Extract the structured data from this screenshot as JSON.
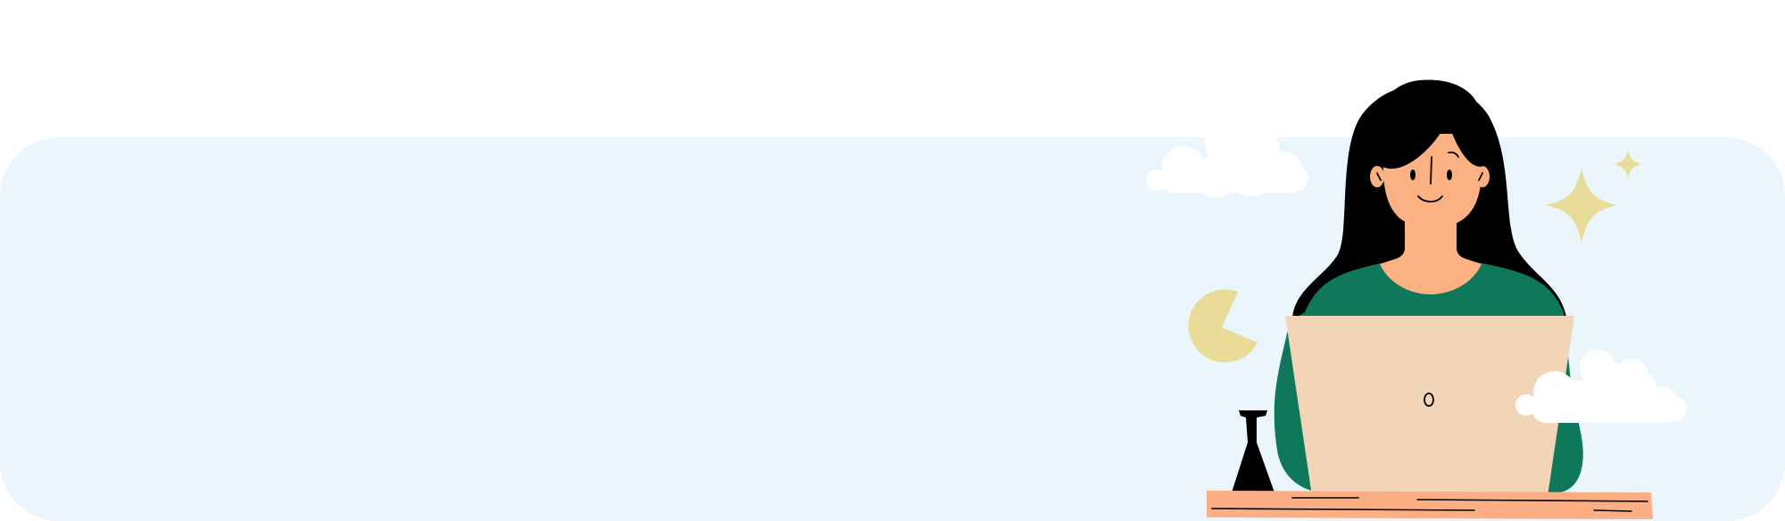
{
  "colors": {
    "page_background": "#ffffff",
    "panel_background": "#eaf5fc",
    "hair": "#000000",
    "skin": "#fbb181",
    "shirt": "#10785a",
    "laptop": "#f2d4b6",
    "desk": "#fcae84",
    "cloud": "#ffffff",
    "accent_shapes": "#e8dc98"
  },
  "illustration": {
    "subject": "woman-working-on-laptop",
    "icons": [
      "cloud-icon",
      "sparkle-icon",
      "pie-shape-icon",
      "lamp-icon",
      "laptop-logo-icon"
    ]
  }
}
